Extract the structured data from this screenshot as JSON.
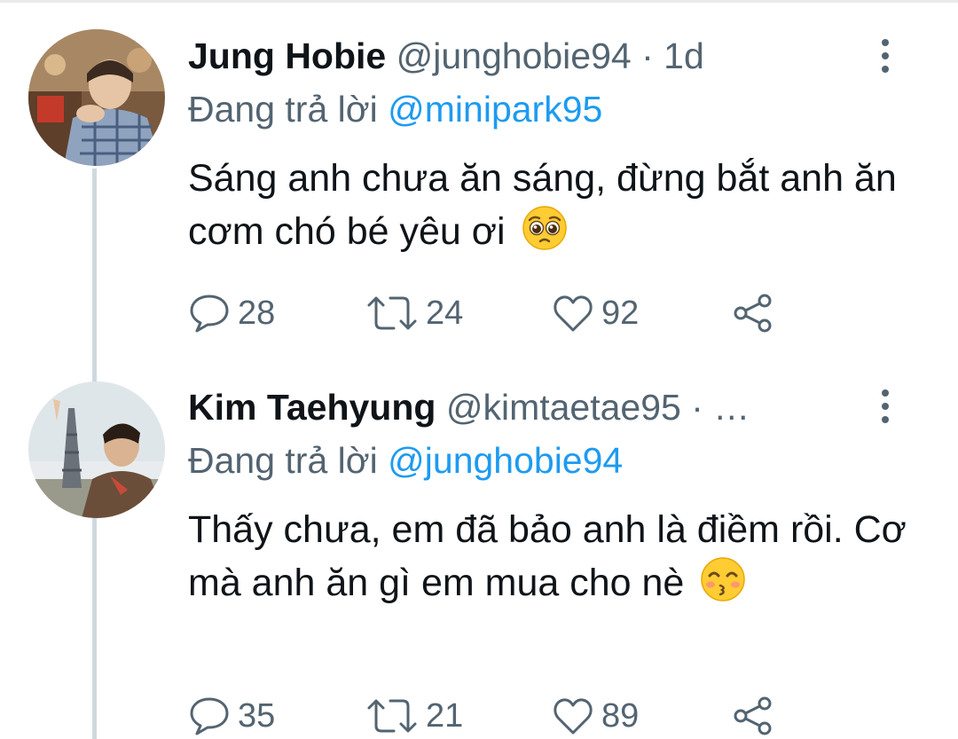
{
  "colors": {
    "link": "#1d9bf0",
    "secondary_text": "#536471",
    "primary_text": "#0f1419",
    "thread_line": "#cfd9de"
  },
  "tweets": [
    {
      "name": "Jung Hobie",
      "handle": "@junghobie94",
      "separator": "·",
      "time": "1d",
      "reply_prefix": "Đang trả lời",
      "reply_to": "@minipark95",
      "text": "Sáng anh chưa ăn sáng, đừng bắt anh ăn cơm chó bé yêu ơi",
      "emoji": "pleading-face",
      "replies": "28",
      "retweets": "24",
      "likes": "92"
    },
    {
      "name": "Kim Taehyung",
      "handle": "@kimtaetae95",
      "separator": "· …",
      "reply_prefix": "Đang trả lời",
      "reply_to": "@junghobie94",
      "text": "Thấy chưa, em đã bảo anh là điềm rồi. Cơ mà anh ăn gì em mua cho nè",
      "emoji": "kissing-face-smiling-eyes",
      "replies": "35",
      "retweets": "21",
      "likes": "89"
    }
  ]
}
